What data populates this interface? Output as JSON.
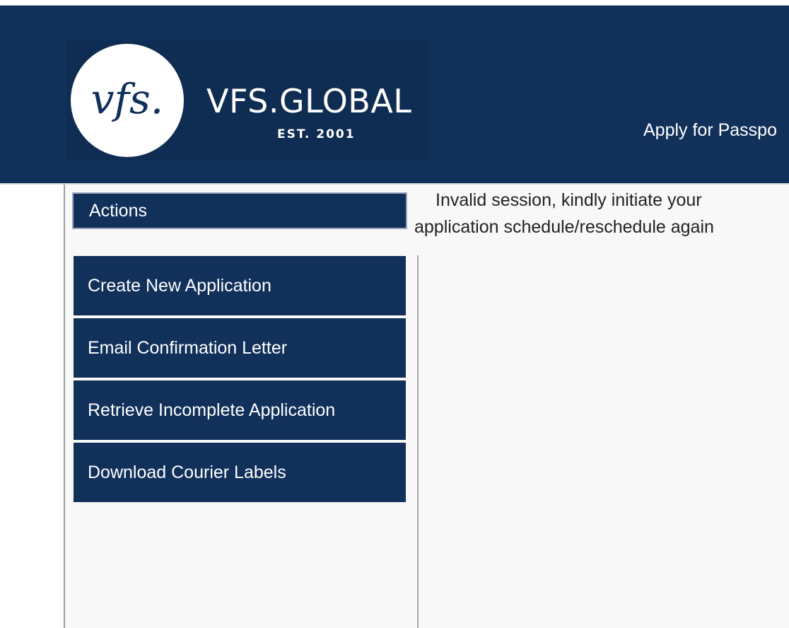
{
  "brand": {
    "logo_monogram": "vfs.",
    "wordmark": "VFS.GLOBAL",
    "established": "EST. 2001"
  },
  "nav": {
    "apply_link": "Apply for Passpo"
  },
  "sidebar": {
    "header": "Actions",
    "items": [
      {
        "label": "Create New Application"
      },
      {
        "label": "Email Confirmation Letter"
      },
      {
        "label": "Retrieve Incomplete Application"
      },
      {
        "label": "Download Courier Labels"
      }
    ]
  },
  "message": {
    "line1": "Invalid session, kindly initiate your",
    "line2": "application schedule/reschedule again"
  },
  "colors": {
    "header_bg": "#11305a",
    "content_bg": "#f8f8f8",
    "text_light": "#ffffff"
  }
}
